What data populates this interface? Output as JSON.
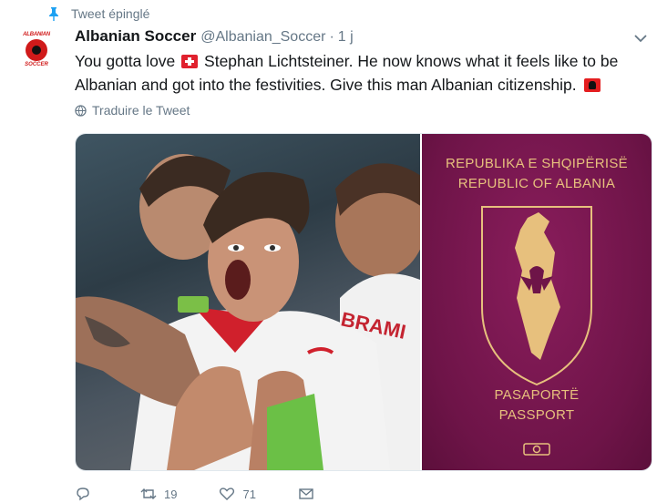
{
  "pinned": {
    "label": "Tweet épinglé"
  },
  "tweet": {
    "name": "Albanian Soccer",
    "handle": "@Albanian_Soccer",
    "separator": "·",
    "time": "1 j",
    "text_part1": "You gotta love",
    "text_part2": "Stephan Lichtsteiner. He now knows what it feels like to be Albanian and got into the festivities. Give this man Albanian citizenship.",
    "translate_label": "Traduire le Tweet"
  },
  "avatar": {
    "top_text": "ALBANIAN",
    "bottom_text": "SOCCER"
  },
  "passport": {
    "line1": "REPUBLIKA E SHQIPËRISË",
    "line2": "REPUBLIC OF ALBANIA",
    "line3": "PASAPORTË",
    "line4": "PASSPORT"
  },
  "photo": {
    "shirt_text": "BRAMI"
  },
  "actions": {
    "reply_count": "",
    "retweet_count": "19",
    "like_count": "71"
  },
  "icons": {
    "pin": "pin-icon",
    "caret": "chevron-down-icon",
    "globe": "globe-icon",
    "reply": "reply-icon",
    "retweet": "retweet-icon",
    "like": "heart-icon",
    "dm": "message-icon",
    "flag_ch": "swiss-flag-icon",
    "flag_al": "albanian-flag-icon"
  },
  "colors": {
    "accent": "#1da1f2",
    "secondary_text": "#657786",
    "passport": "#6e1448",
    "gold": "#e7c07d"
  }
}
